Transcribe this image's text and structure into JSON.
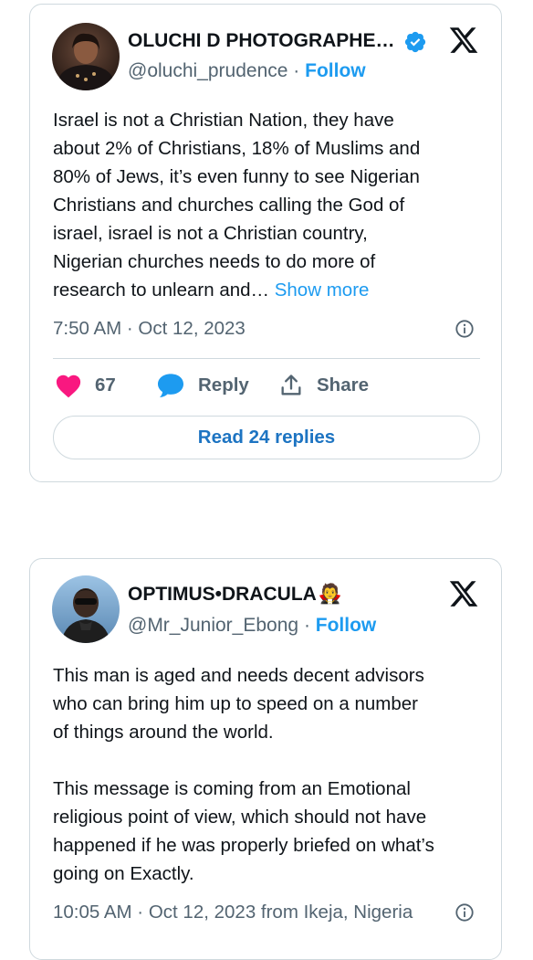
{
  "tweets": [
    {
      "author_name": "OLUCHI D PHOTOGRAPHE…",
      "verified": true,
      "handle": "@oluchi_prudence",
      "separator": "·",
      "follow_label": "Follow",
      "text_lines": [
        "Israel is not a Christian Nation, they have",
        "about 2% of Christians, 18% of Muslims and",
        "80% of Jews, it’s even funny to see Nigerian",
        "Christians and churches calling the God of",
        "israel, israel is not a Christian country,",
        "Nigerian churches needs to do more of",
        "research to unlearn and… "
      ],
      "show_more_label": "Show more",
      "timestamp": "7:50 AM · Oct 12, 2023",
      "like_count": "67",
      "reply_label": "Reply",
      "share_label": "Share",
      "read_replies_label": "Read 24 replies"
    },
    {
      "author_name": "OPTIMUS•DRACULA",
      "author_emoji": "🧛",
      "handle": "@Mr_Junior_Ebong",
      "separator": "·",
      "follow_label": "Follow",
      "paragraphs": [
        [
          "This man is aged and needs decent advisors",
          "who can bring him up to speed on a number",
          "of things around the world."
        ],
        [
          "This message is coming from an Emotional",
          "religious point of view, which should not have",
          "happened if he was properly briefed on what’s",
          "going on Exactly."
        ]
      ],
      "timestamp": "10:05 AM · Oct 12, 2023 from Ikeja, Nigeria"
    }
  ],
  "colors": {
    "accent": "#1d9bf0",
    "link_dark": "#1d74c2",
    "like": "#f91880",
    "muted": "#536471",
    "border": "#cfd9de"
  },
  "icons": [
    "x-logo-icon",
    "verified-badge-icon",
    "info-icon",
    "heart-icon",
    "reply-bubble-icon",
    "share-icon"
  ]
}
